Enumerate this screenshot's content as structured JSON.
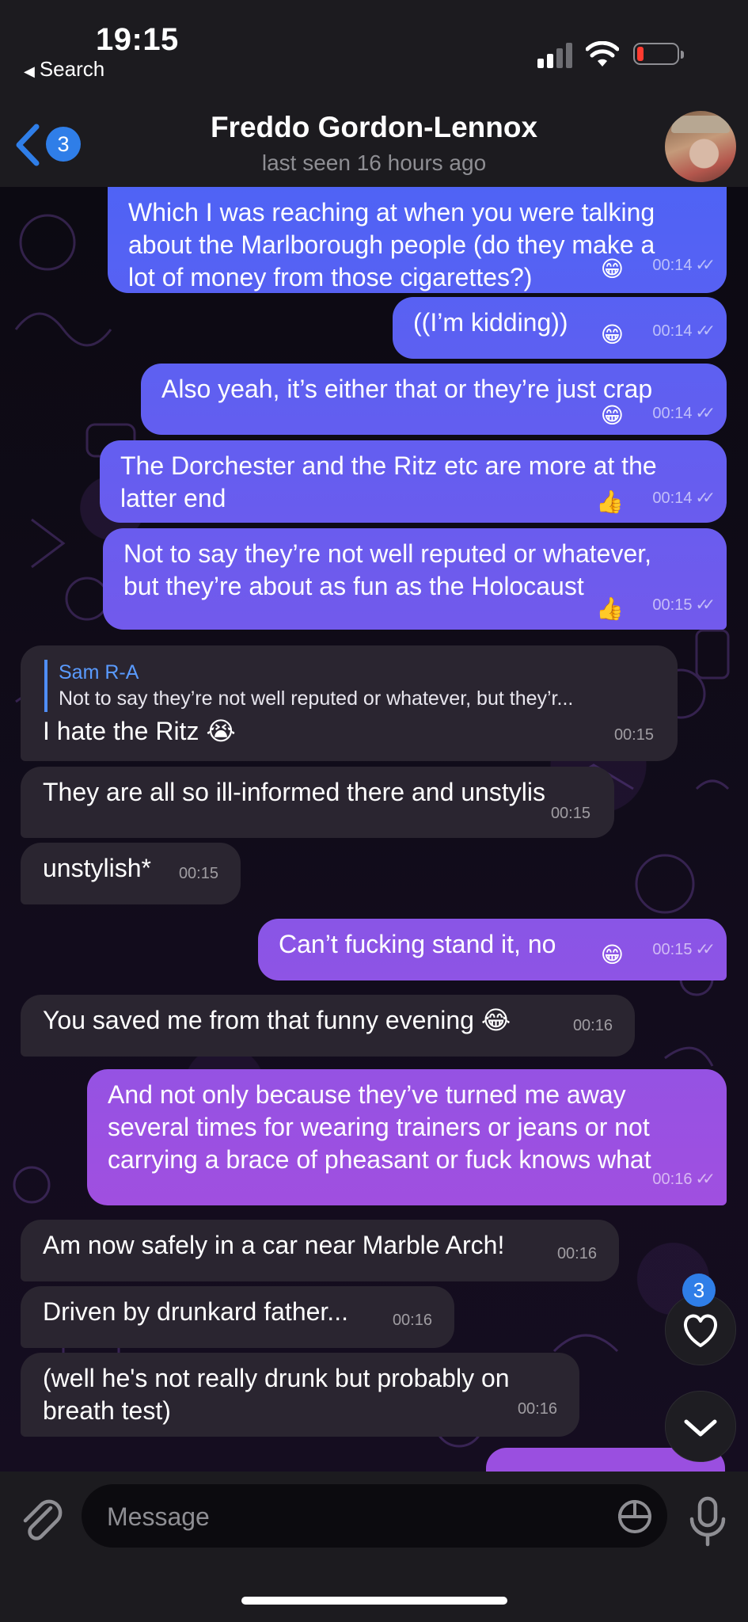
{
  "status_bar": {
    "time": "19:15",
    "back_label": "Search"
  },
  "header": {
    "back_count": "3",
    "name": "Freddo Gordon-Lennox",
    "last_seen": "last seen 16 hours ago"
  },
  "messages": [
    {
      "dir": "out",
      "lines": [
        "Which I was reaching at when you were talking",
        "about the Marlborough people (do they make a",
        "lot of money from those cigarettes?)"
      ],
      "time": "00:14",
      "reaction": "😁"
    },
    {
      "dir": "out",
      "lines": [
        "((I’m kidding))"
      ],
      "time": "00:14",
      "reaction": "😁"
    },
    {
      "dir": "out",
      "lines": [
        "Also yeah, it’s either that or they’re just crap"
      ],
      "time": "00:14",
      "reaction": "😁"
    },
    {
      "dir": "out",
      "lines": [
        "The Dorchester and the Ritz etc are more at the",
        "latter end"
      ],
      "time": "00:14",
      "reaction": "👍"
    },
    {
      "dir": "out",
      "lines": [
        "Not to say they’re not well reputed or whatever,",
        "but they’re about as fun as the Holocaust"
      ],
      "time": "00:15",
      "reaction": "👍"
    },
    {
      "dir": "in",
      "reply_name": "Sam R-A",
      "reply_text": "Not to say they’re not well reputed or whatever, but they’r...",
      "lines": [
        "I hate the Ritz 😭"
      ],
      "time": "00:15"
    },
    {
      "dir": "in",
      "lines": [
        "They are all so ill-informed there and unstylis"
      ],
      "time": "00:15"
    },
    {
      "dir": "in",
      "lines": [
        "unstylish*"
      ],
      "time": "00:15"
    },
    {
      "dir": "out",
      "lines": [
        "Can’t fucking stand it, no"
      ],
      "time": "00:15",
      "reaction": "😁"
    },
    {
      "dir": "in",
      "lines": [
        "You saved me from that funny evening 😂"
      ],
      "time": "00:16"
    },
    {
      "dir": "out",
      "lines": [
        "And not only because they’ve turned me away",
        "several times for wearing trainers or jeans or not",
        "carrying a brace of pheasant or fuck knows what"
      ],
      "time": "00:16"
    },
    {
      "dir": "in",
      "lines": [
        "Am now safely in a car near Marble Arch!"
      ],
      "time": "00:16"
    },
    {
      "dir": "in",
      "lines": [
        "Driven by drunkard father..."
      ],
      "time": "00:16"
    },
    {
      "dir": "in",
      "lines": [
        "(well he's not really drunk but probably on",
        "breath test)"
      ],
      "time": "00:16"
    }
  ],
  "fab": {
    "reactions_badge": "3"
  },
  "input": {
    "placeholder": "Message"
  },
  "colors": {
    "accent": "#2f7ee8",
    "bubble_out_top": "#4f63f5",
    "bubble_out_bottom": "#a14fe0",
    "bubble_in": "#2a2530"
  },
  "icons": {
    "back": "chevron-left-icon",
    "attach": "paperclip-icon",
    "sticker": "sticker-icon",
    "mic": "microphone-icon",
    "heart": "heart-icon",
    "scroll": "chevron-down-icon"
  }
}
